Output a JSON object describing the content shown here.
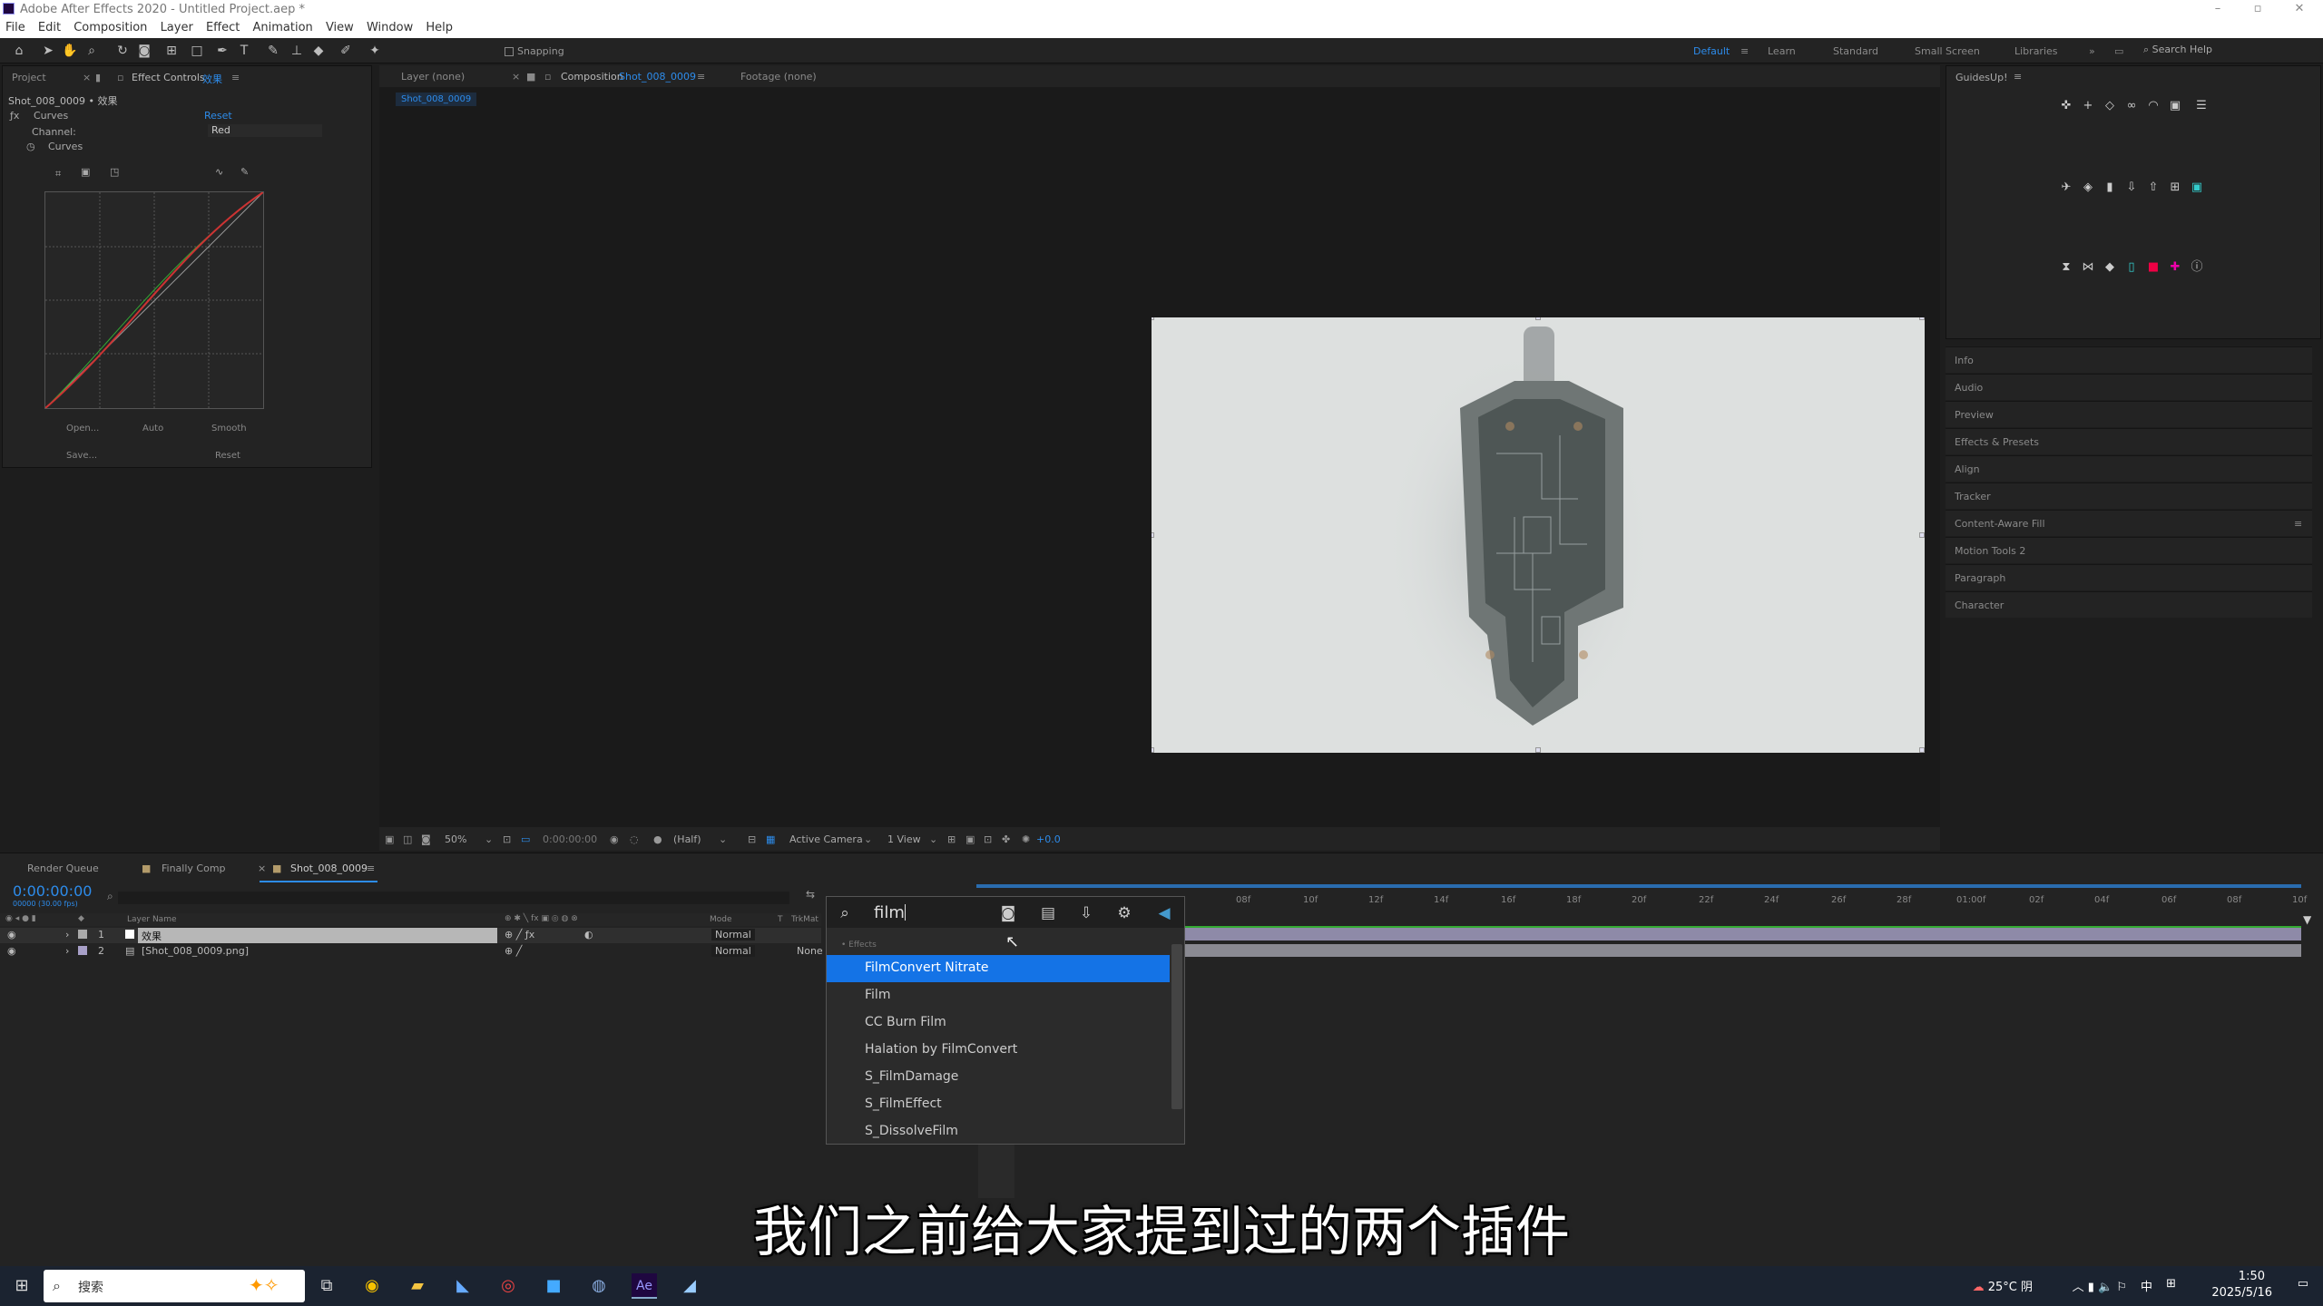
{
  "titlebar": {
    "title": "Adobe After Effects 2020 - Untitled Project.aep *"
  },
  "menu": [
    "File",
    "Edit",
    "Composition",
    "Layer",
    "Effect",
    "Animation",
    "View",
    "Window",
    "Help"
  ],
  "toolbar": {
    "snapping": "Snapping",
    "search_help": "Search Help"
  },
  "workspaces": [
    {
      "label": "Default",
      "active": true
    },
    {
      "label": "Learn",
      "active": false
    },
    {
      "label": "Standard",
      "active": false
    },
    {
      "label": "Small Screen",
      "active": false
    },
    {
      "label": "Libraries",
      "active": false
    }
  ],
  "effect_panel": {
    "tab_project": "Project",
    "tab_effect_controls": "Effect Controls",
    "tab_effect_controls_target": "效果",
    "layer_path": "Shot_008_0009 • 效果",
    "effect_name": "Curves",
    "reset": "Reset",
    "channel_label": "Channel:",
    "channel_value": "Red",
    "curves_label": "Curves",
    "buttons": {
      "open": "Open...",
      "auto": "Auto",
      "smooth": "Smooth",
      "save": "Save...",
      "reset": "Reset"
    }
  },
  "viewer": {
    "tab_layer": "Layer (none)",
    "tab_comp": "Composition",
    "tab_comp_name": "Shot_008_0009",
    "tab_footage": "Footage (none)",
    "subtab": "Shot_008_0009",
    "zoom": "50%",
    "timecode": "0:00:00:00",
    "resolution": "(Half)",
    "camera": "Active Camera",
    "views": "1 View",
    "exposure": "+0.0"
  },
  "right_panel": {
    "guides_title": "GuidesUp!",
    "items": [
      "Info",
      "Audio",
      "Preview",
      "Effects & Presets",
      "Align",
      "Tracker",
      "Content-Aware Fill",
      "Motion Tools 2",
      "Paragraph",
      "Character"
    ]
  },
  "timeline": {
    "tabs": [
      "Render Queue",
      "Finally Comp",
      "Shot_008_0009"
    ],
    "timecode": "0:00:00:00",
    "timecode_sub": "00000 (30.00 fps)",
    "headers": {
      "layer_name": "Layer Name",
      "mode": "Mode",
      "trkmat": "TrkMat",
      "t": "T"
    },
    "layers": [
      {
        "num": "1",
        "name": "效果",
        "mode": "Normal",
        "trkmat": ""
      },
      {
        "num": "2",
        "name": "[Shot_008_0009.png]",
        "mode": "Normal",
        "trkmat": "None"
      }
    ],
    "ruler": [
      "08f",
      "10f",
      "12f",
      "14f",
      "16f",
      "18f",
      "20f",
      "22f",
      "24f",
      "26f",
      "28f",
      "01:00f",
      "02f",
      "04f",
      "06f",
      "08f",
      "10f"
    ]
  },
  "search_popup": {
    "query": "film",
    "category": "Effects",
    "results": [
      "FilmConvert Nitrate",
      "Film",
      "CC Burn Film",
      "Halation by FilmConvert",
      "S_FilmDamage",
      "S_FilmEffect",
      "S_DissolveFilm"
    ]
  },
  "subtitle": "我们之前给大家提到过的两个插件",
  "taskbar": {
    "search": "搜索",
    "weather": "25°C 阴",
    "ime": "中",
    "time": "1:50",
    "date": "2025/5/16"
  },
  "colors": {
    "accent": "#2d8ceb",
    "selection": "#1473e6",
    "layer_bar": "#8e8aa8",
    "panel": "#232323"
  }
}
